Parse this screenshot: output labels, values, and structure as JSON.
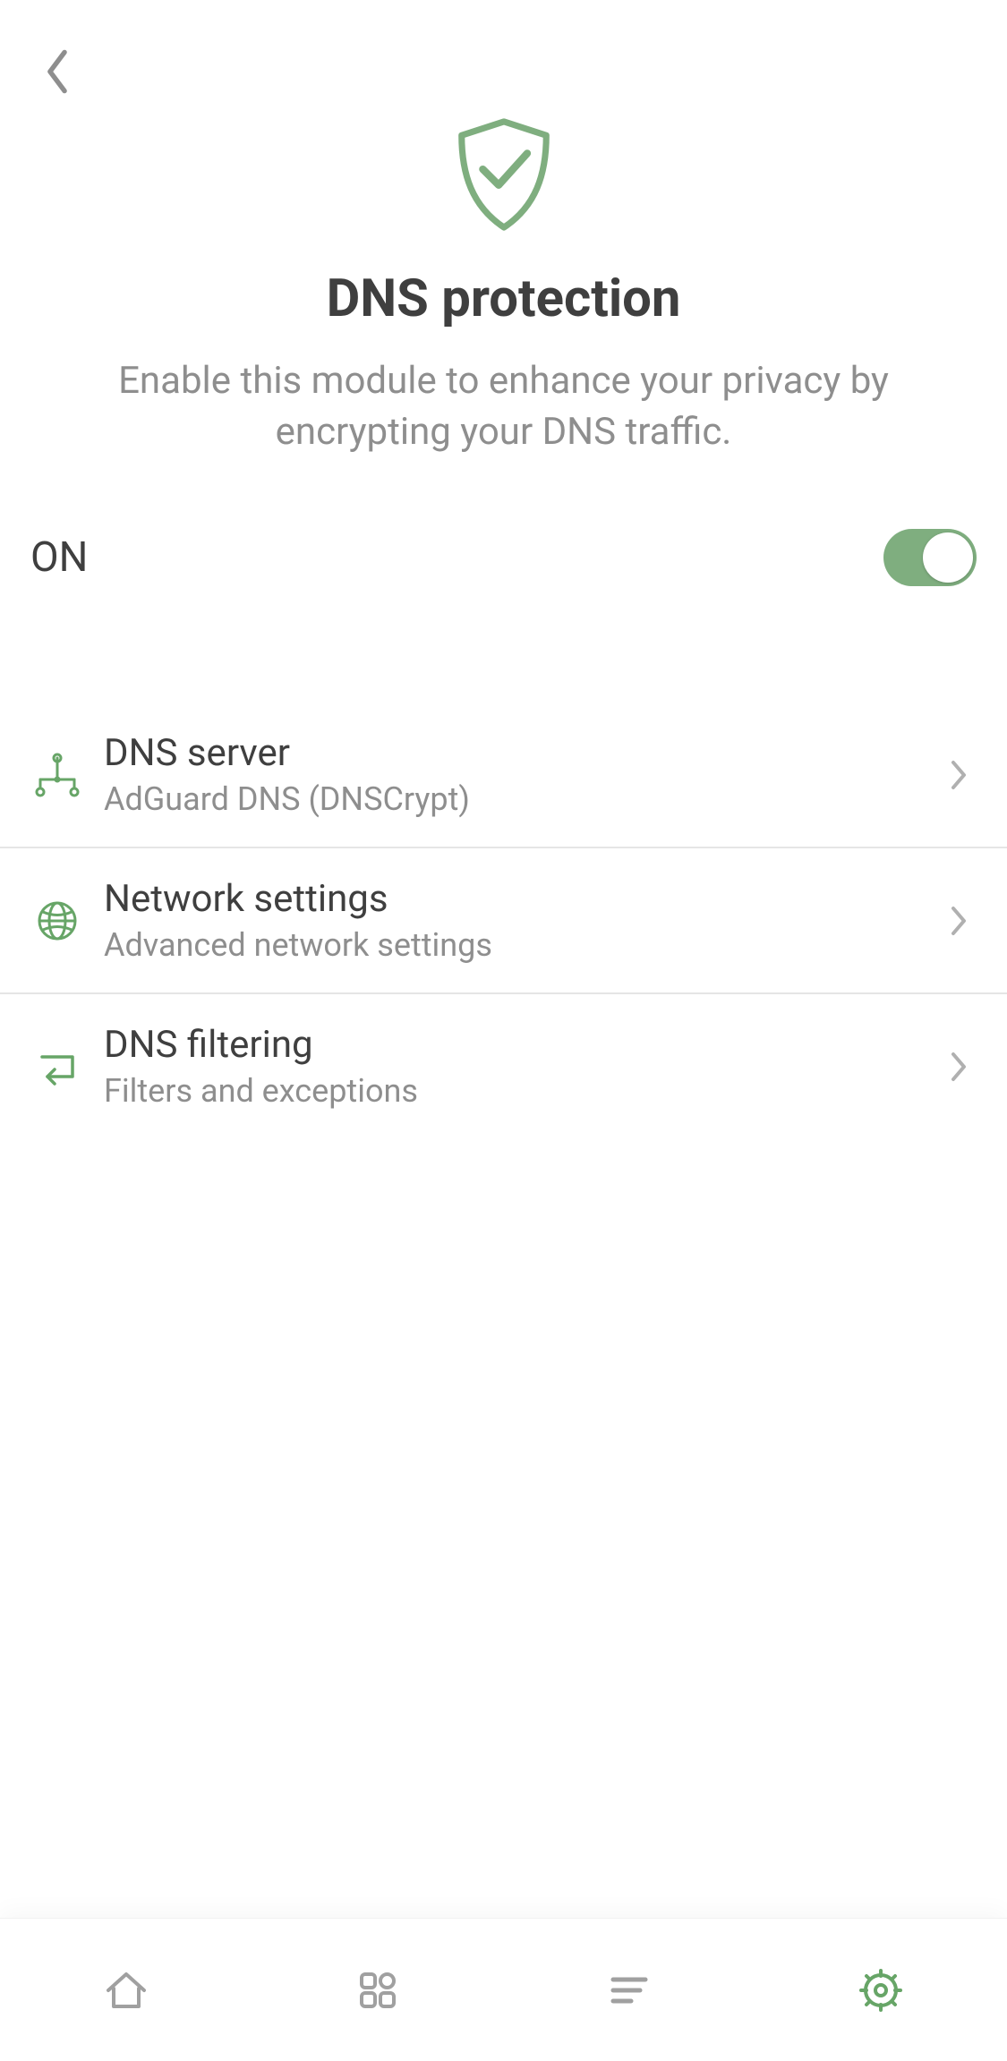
{
  "header": {},
  "hero": {
    "title": "DNS protection",
    "subtitle": "Enable this module to enhance your privacy by encrypting your DNS traffic."
  },
  "toggle": {
    "label": "ON",
    "on": true
  },
  "items": [
    {
      "title": "DNS server",
      "subtitle": "AdGuard DNS (DNSCrypt)"
    },
    {
      "title": "Network settings",
      "subtitle": "Advanced network settings"
    },
    {
      "title": "DNS filtering",
      "subtitle": "Filters and exceptions"
    }
  ],
  "colors": {
    "accent": "#67a567",
    "muted": "#a0a0a0"
  }
}
